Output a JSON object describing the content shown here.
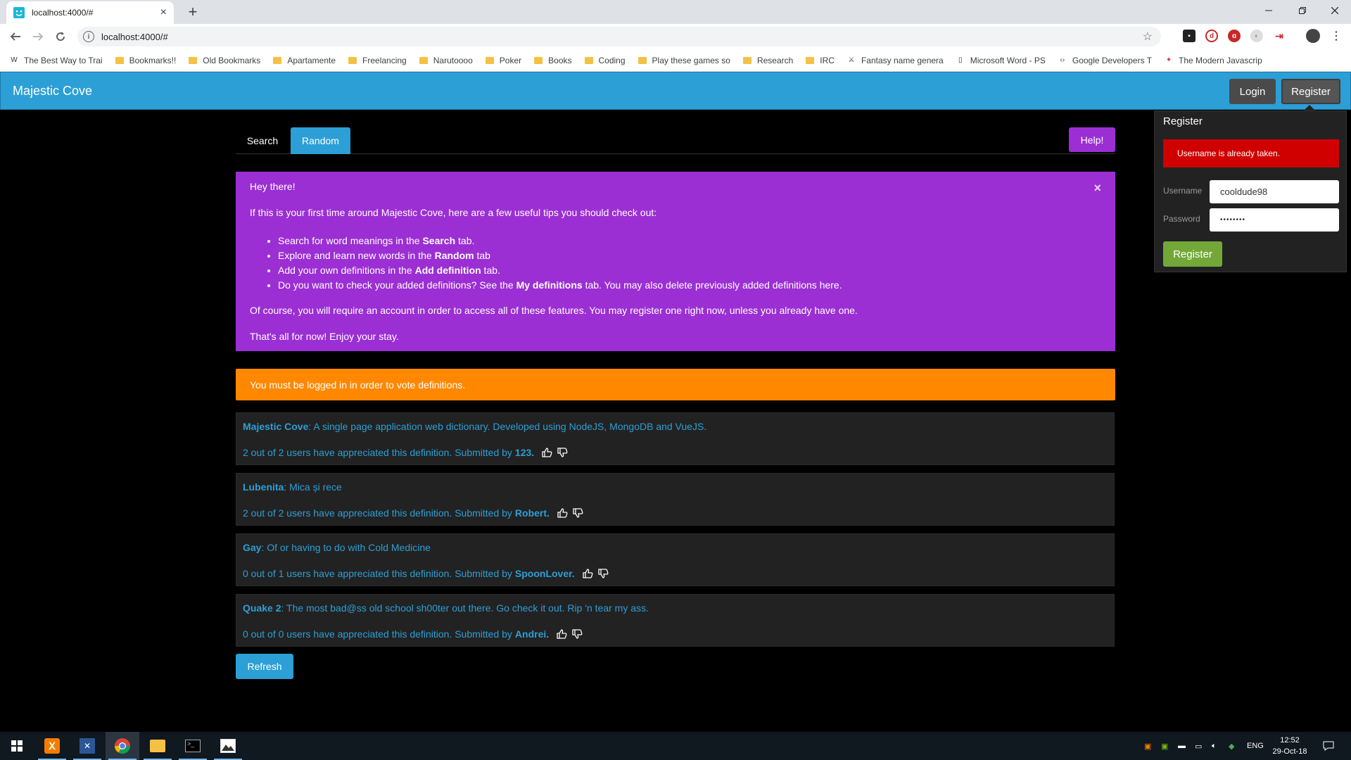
{
  "browser": {
    "tab_title": "localhost:4000/#",
    "tab_close": "×",
    "new_tab": "+",
    "url": "localhost:4000/#",
    "info_icon_glyph": "i",
    "bookmarks": [
      {
        "label": "The Best Way to Trai",
        "icon": "w-icon"
      },
      {
        "label": "Bookmarks!!",
        "icon": "folder-icon"
      },
      {
        "label": "Old Bookmarks",
        "icon": "folder-icon"
      },
      {
        "label": "Apartamente",
        "icon": "folder-icon"
      },
      {
        "label": "Freelancing",
        "icon": "folder-icon"
      },
      {
        "label": "Narutoooo",
        "icon": "folder-icon"
      },
      {
        "label": "Poker",
        "icon": "folder-icon"
      },
      {
        "label": "Books",
        "icon": "folder-icon"
      },
      {
        "label": "Coding",
        "icon": "folder-icon"
      },
      {
        "label": "Play these games so",
        "icon": "folder-icon"
      },
      {
        "label": "Research",
        "icon": "folder-icon"
      },
      {
        "label": "IRC",
        "icon": "folder-icon"
      },
      {
        "label": "Fantasy name genera",
        "icon": "dragon-icon"
      },
      {
        "label": "Microsoft Word - PS",
        "icon": "page-icon"
      },
      {
        "label": "Google Developers T",
        "icon": "code-icon"
      },
      {
        "label": "The Modern Javascrip",
        "icon": "figure-icon"
      }
    ]
  },
  "app": {
    "brand": "Majestic Cove",
    "login_label": "Login",
    "register_label": "Register",
    "colors": {
      "primary": "#2c9fd6",
      "purple": "#9b2fd4",
      "warning": "#ff8800",
      "danger": "#d10000",
      "success": "#73a839"
    }
  },
  "register_panel": {
    "title": "Register",
    "error": "Username is already taken.",
    "username_label": "Username",
    "username_value": "cooldude98",
    "password_label": "Password",
    "password_value": "••••••••",
    "submit_label": "Register"
  },
  "tabs": {
    "search": "Search",
    "random": "Random",
    "help": "Help!"
  },
  "welcome": {
    "close": "×",
    "greeting": "Hey there!",
    "intro": "If this is your first time around Majestic Cove, here are a few useful tips you should check out:",
    "tips": [
      {
        "pre": "Search for word meanings in the ",
        "bold": "Search",
        "post": " tab."
      },
      {
        "pre": "Explore and learn new words in the ",
        "bold": "Random",
        "post": " tab"
      },
      {
        "pre": "Add your own definitions in the ",
        "bold": "Add definition",
        "post": " tab."
      },
      {
        "pre": "Do you want to check your added definitions? See the ",
        "bold": "My definitions",
        "post": " tab. You may also delete previously added definitions here."
      }
    ],
    "account_note": "Of course, you will require an account in order to access all of these features. You may register one right now, unless you already have one.",
    "signoff": "That's all for now! Enjoy your stay."
  },
  "warning": "You must be logged in in order to vote definitions.",
  "definitions": [
    {
      "word": "Majestic Cove",
      "meaning": ": A single page application web dictionary. Developed using NodeJS, MongoDB and VueJS.",
      "stats": "2 out of 2 users have appreciated this definition. Submitted by",
      "author": "123."
    },
    {
      "word": "Lubenita",
      "meaning": ": Mica și rece",
      "stats": "2 out of 2 users have appreciated this definition. Submitted by",
      "author": "Robert."
    },
    {
      "word": "Gay",
      "meaning": ": Of or having to do with Cold Medicine",
      "stats": "0 out of 1 users have appreciated this definition. Submitted by",
      "author": "SpoonLover."
    },
    {
      "word": "Quake 2",
      "meaning": ": The most bad@ss old school sh00ter out there. Go check it out. Rip 'n tear my ass.",
      "stats": "0 out of 0 users have appreciated this definition. Submitted by",
      "author": "Andrei."
    }
  ],
  "refresh_label": "Refresh",
  "taskbar": {
    "language": "ENG",
    "time": "12:52",
    "date": "29-Oct-18",
    "apps": [
      "start-icon",
      "xampp-icon",
      "visual-studio-icon",
      "chrome-icon",
      "file-explorer-icon",
      "terminal-icon",
      "photos-icon"
    ]
  }
}
